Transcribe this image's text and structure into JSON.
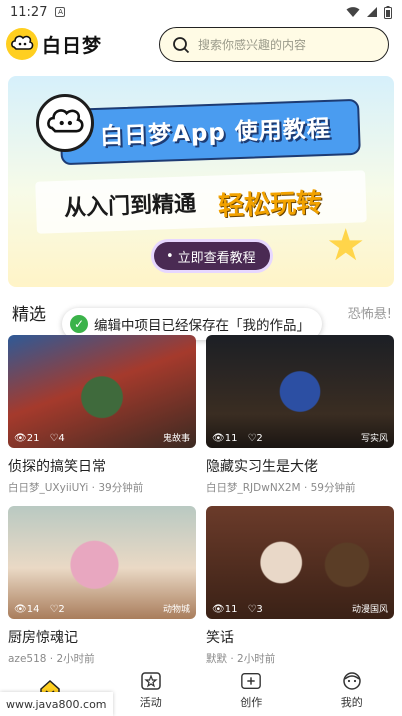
{
  "status_bar": {
    "time": "11:27",
    "sim_label": "A"
  },
  "header": {
    "logo_text": "白日梦",
    "search_placeholder": "搜索你感兴趣的内容"
  },
  "banner": {
    "title": "白日梦App 使用教程",
    "subtitle_left": "从入门到精通",
    "subtitle_right": "轻松玩转",
    "cta_label": "立即查看教程"
  },
  "section": {
    "title": "精选",
    "more_text": "恐怖悬!"
  },
  "toast": {
    "text": "编辑中项目已经保存在「我的作品」"
  },
  "cards": [
    {
      "views": "21",
      "likes": "4",
      "tag": "鬼故事",
      "title": "侦探的搞笑日常",
      "meta": "白日梦_UXyiiUYi · 39分钟前"
    },
    {
      "views": "11",
      "likes": "2",
      "tag": "写实风",
      "title": "隐藏实习生是大佬",
      "meta": "白日梦_RJDwNX2M · 59分钟前"
    },
    {
      "views": "14",
      "likes": "2",
      "tag": "动物城",
      "title": "厨房惊魂记",
      "meta": "aze518 · 2小时前"
    },
    {
      "views": "11",
      "likes": "3",
      "tag": "动漫国风",
      "title": "笑话",
      "meta": "默默 · 2小时前"
    }
  ],
  "bottom_nav": [
    {
      "label": "",
      "icon": "home-icon"
    },
    {
      "label": "活动",
      "icon": "activity-icon"
    },
    {
      "label": "创作",
      "icon": "create-icon"
    },
    {
      "label": "我的",
      "icon": "profile-icon"
    }
  ],
  "watermark": "www.java800.com",
  "colors": {
    "accent": "#ffcf20",
    "toast_check": "#3bb34a",
    "cta_bg": "#4a2a53"
  }
}
